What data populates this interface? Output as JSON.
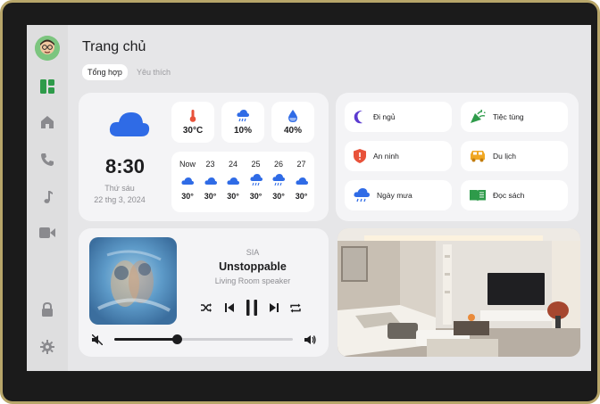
{
  "header": {
    "title": "Trang chủ"
  },
  "tabs": [
    {
      "label": "Tổng hợp",
      "active": true
    },
    {
      "label": "Yêu thích",
      "active": false
    }
  ],
  "sidebar": {
    "items": [
      {
        "icon": "dashboard-icon",
        "active": true
      },
      {
        "icon": "home-icon"
      },
      {
        "icon": "phone-icon"
      },
      {
        "icon": "music-note-icon"
      },
      {
        "icon": "video-camera-icon"
      },
      {
        "icon": "lock-icon"
      },
      {
        "icon": "gear-icon"
      }
    ]
  },
  "weather": {
    "time": "8:30",
    "day": "Thứ sáu",
    "date": "22 thg 3, 2024",
    "stats": [
      {
        "icon": "thermometer-icon",
        "value": "30°C"
      },
      {
        "icon": "rain-cloud-icon",
        "value": "10%"
      },
      {
        "icon": "humidity-drop-icon",
        "value": "40%"
      }
    ],
    "forecast": [
      {
        "day": "Now",
        "temp": "30°",
        "rain": false
      },
      {
        "day": "23",
        "temp": "30°",
        "rain": false
      },
      {
        "day": "24",
        "temp": "30°",
        "rain": false
      },
      {
        "day": "25",
        "temp": "30°",
        "rain": true
      },
      {
        "day": "26",
        "temp": "30°",
        "rain": true
      },
      {
        "day": "27",
        "temp": "30°",
        "rain": false
      }
    ]
  },
  "scenes": [
    {
      "label": "Đi ngủ",
      "icon": "moon-icon",
      "color": "#5b3bd0"
    },
    {
      "label": "Tiệc tùng",
      "icon": "party-popper-icon",
      "color": "#2e9b4a"
    },
    {
      "label": "An ninh",
      "icon": "shield-icon",
      "color": "#e8523a"
    },
    {
      "label": "Du lịch",
      "icon": "car-icon",
      "color": "#f0a722"
    },
    {
      "label": "Ngày mưa",
      "icon": "rain-cloud-icon",
      "color": "#2f6be6"
    },
    {
      "label": "Đọc sách",
      "icon": "book-icon",
      "color": "#2e9b4a"
    }
  ],
  "player": {
    "artist": "SIA",
    "track": "Unstoppable",
    "device": "Living Room speaker",
    "volume": 0.35
  },
  "colors": {
    "accent": "#2f6be6",
    "green": "#2e9b4a"
  }
}
